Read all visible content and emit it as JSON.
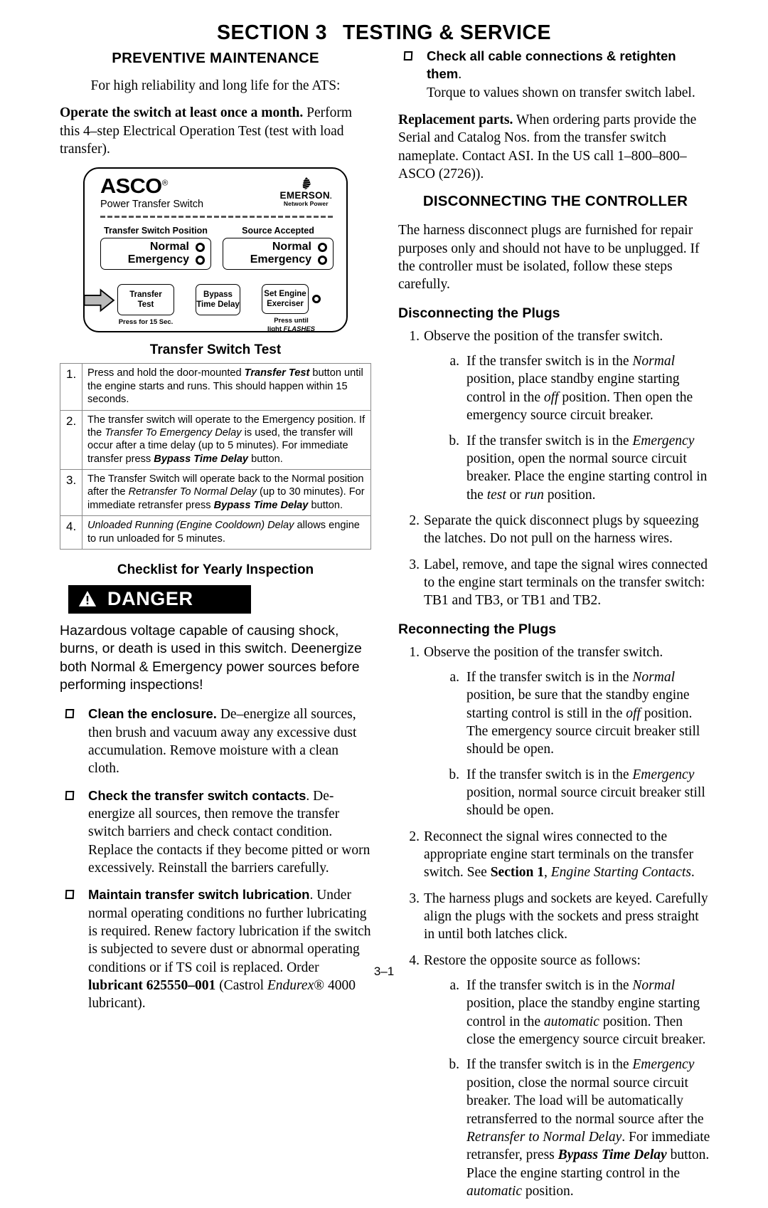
{
  "header": {
    "section_number": "SECTION 3",
    "title": "TESTING & SERVICE"
  },
  "left_column": {
    "heading": "PREVENTIVE MAINTENANCE",
    "intro_line": "For high reliability and long life for the ATS:",
    "operate_bold": "Operate the switch at least once a month.",
    "operate_rest": " Perform this 4–step Electrical Operation Test (test with load transfer).",
    "panel": {
      "brand": "ASCO",
      "brand_reg": "®",
      "brand_sub": "Power Transfer Switch",
      "partner_name": "EMERSON",
      "partner_dot": ".",
      "partner_tagline": "Network Power",
      "indicator_groups": [
        {
          "title": "Transfer Switch Position",
          "rows": [
            "Normal",
            "Emergency"
          ]
        },
        {
          "title": "Source Accepted",
          "rows": [
            "Normal",
            "Emergency"
          ]
        }
      ],
      "buttons": [
        {
          "line1": "Transfer",
          "line2": "Test",
          "note": "Press for 15 Sec.",
          "has_led": false
        },
        {
          "line1": "Bypass",
          "line2": "Time Delay",
          "note": "",
          "has_led": false
        },
        {
          "line1": "Set Engine",
          "line2": "Exerciser",
          "note_line1": "Press until",
          "note_line2_plain": "light ",
          "note_line2_italic": "FLASHES",
          "has_led": true
        }
      ]
    },
    "transfer_test": {
      "title": "Transfer Switch Test",
      "rows": [
        {
          "num": "1.",
          "segments": [
            {
              "t": "Press and hold the door-mounted ",
              "s": "plain"
            },
            {
              "t": "Transfer Test",
              "s": "bolditalic"
            },
            {
              "t": " button until the engine starts and runs. This should happen within 15 seconds.",
              "s": "plain"
            }
          ]
        },
        {
          "num": "2.",
          "segments": [
            {
              "t": "The transfer switch will operate to the Emergency position.  If the ",
              "s": "plain"
            },
            {
              "t": "Transfer To Emergency Delay",
              "s": "italic"
            },
            {
              "t": " is used, the transfer will occur after a time delay (up to 5 minutes). For immediate transfer press ",
              "s": "plain"
            },
            {
              "t": "Bypass Time Delay",
              "s": "bolditalic"
            },
            {
              "t": " button.",
              "s": "plain"
            }
          ]
        },
        {
          "num": "3.",
          "segments": [
            {
              "t": "The Transfer Switch will operate back to the Normal position after the ",
              "s": "plain"
            },
            {
              "t": "Retransfer To Normal Delay",
              "s": "italic"
            },
            {
              "t": " (up to 30 minutes).  For immediate retransfer press ",
              "s": "plain"
            },
            {
              "t": "Bypass Time Delay",
              "s": "bolditalic"
            },
            {
              "t": " button.",
              "s": "plain"
            }
          ]
        },
        {
          "num": "4.",
          "segments": [
            {
              "t": "Unloaded Running (Engine Cooldown) Delay",
              "s": "italic"
            },
            {
              "t": " allows engine to run unloaded for 5 minutes.",
              "s": "plain"
            }
          ]
        }
      ]
    },
    "checklist_title": "Checklist for Yearly Inspection",
    "danger": {
      "label": "DANGER",
      "icon": "warning-triangle-icon",
      "text": "Hazardous voltage capable of causing shock, burns, or death is used in this switch. Deenergize both Normal & Emergency power sources before performing inspections!"
    },
    "checklist_items": [
      {
        "lead": "Clean the enclosure.",
        "body": " De–energize all sources, then brush and vacuum away any excessive dust accumulation. Remove moisture with a clean cloth."
      },
      {
        "lead": "Check the transfer switch contacts",
        "body": ".  De-energize all sources, then remove the transfer switch barriers and check contact condition.  Replace the contacts if they become pitted or worn excessively.  Reinstall the barriers carefully."
      },
      {
        "lead": "Maintain transfer switch lubrication",
        "body": ". Under normal operating conditions no further lubricating is required.  Renew factory lubrication if the switch is subjected to severe dust or abnormal operating conditions or if TS coil is replaced. Order ",
        "order_bold": "lubricant 625550–001",
        "tail_plain_1": " (Castrol ",
        "tail_italic": "Endurex",
        "tail_reg": "®",
        "tail_plain_2": " 4000 lubricant)."
      }
    ]
  },
  "right_column": {
    "cable_item": {
      "lead": "Check all cable connections & retighten them",
      "lead_tail": ".",
      "body": "Torque to values shown on transfer switch label."
    },
    "replacement_parts": {
      "lead": "Replacement parts.",
      "body": " When ordering parts provide the Serial and Catalog Nos. from the transfer switch nameplate.  Contact ASI. In the US call 1–800–800–ASCO (2726))."
    },
    "heading": "DISCONNECTING THE CONTROLLER",
    "intro": "The harness disconnect plugs are furnished for repair purposes only and should not have to be unplugged. If the controller must be isolated, follow these steps carefully.",
    "disconnect": {
      "title": "Disconnecting the Plugs",
      "steps": [
        {
          "mk": "1.",
          "segments": [
            {
              "t": "Observe the position of the transfer switch.",
              "s": "plain"
            }
          ],
          "subs": [
            {
              "mk": "a.",
              "segments": [
                {
                  "t": "If the transfer switch is in the ",
                  "s": "plain"
                },
                {
                  "t": "Normal",
                  "s": "italic"
                },
                {
                  "t": " position, place standby engine starting control in the ",
                  "s": "plain"
                },
                {
                  "t": "off",
                  "s": "italic"
                },
                {
                  "t": " position.  Then open the emergency source circuit breaker.",
                  "s": "plain"
                }
              ]
            },
            {
              "mk": "b.",
              "segments": [
                {
                  "t": "If the transfer switch is in the ",
                  "s": "plain"
                },
                {
                  "t": "Emergency",
                  "s": "italic"
                },
                {
                  "t": " position, open the normal source circuit breaker.  Place the engine starting control in the ",
                  "s": "plain"
                },
                {
                  "t": "test",
                  "s": "italic"
                },
                {
                  "t": " or ",
                  "s": "plain"
                },
                {
                  "t": "run",
                  "s": "italic"
                },
                {
                  "t": " position.",
                  "s": "plain"
                }
              ]
            }
          ]
        },
        {
          "mk": "2.",
          "segments": [
            {
              "t": "Separate the quick disconnect plugs by squeezing the latches.  Do not pull on the harness wires.",
              "s": "plain"
            }
          ],
          "subs": []
        },
        {
          "mk": "3.",
          "segments": [
            {
              "t": "Label, remove, and tape the signal wires connected to the engine start terminals on the transfer switch: TB1 and TB3, or TB1 and TB2.",
              "s": "plain"
            }
          ],
          "subs": []
        }
      ]
    },
    "reconnect": {
      "title": "Reconnecting the Plugs",
      "steps": [
        {
          "mk": "1.",
          "segments": [
            {
              "t": "Observe the position of the transfer switch.",
              "s": "plain"
            }
          ],
          "subs": [
            {
              "mk": "a.",
              "segments": [
                {
                  "t": "If the transfer switch is in the ",
                  "s": "plain"
                },
                {
                  "t": "Normal",
                  "s": "italic"
                },
                {
                  "t": " position, be sure that the standby engine starting control is still in the ",
                  "s": "plain"
                },
                {
                  "t": "off",
                  "s": "italic"
                },
                {
                  "t": " position.  The emergency source circuit breaker still should be open.",
                  "s": "plain"
                }
              ]
            },
            {
              "mk": "b.",
              "segments": [
                {
                  "t": "If the transfer switch is in the ",
                  "s": "plain"
                },
                {
                  "t": "Emergency",
                  "s": "italic"
                },
                {
                  "t": " position, normal source circuit breaker still should be open.",
                  "s": "plain"
                }
              ]
            }
          ]
        },
        {
          "mk": "2.",
          "segments": [
            {
              "t": "Reconnect the signal wires connected to the appropriate engine start terminals on the transfer switch.  See ",
              "s": "plain"
            },
            {
              "t": "Section 1",
              "s": "bold"
            },
            {
              "t": ", ",
              "s": "plain"
            },
            {
              "t": "Engine Starting Contacts",
              "s": "italic"
            },
            {
              "t": ".",
              "s": "plain"
            }
          ],
          "subs": []
        },
        {
          "mk": "3.",
          "segments": [
            {
              "t": "The harness plugs and sockets are keyed. Carefully align the plugs with the sockets and press straight in until both latches click.",
              "s": "plain"
            }
          ],
          "subs": []
        },
        {
          "mk": "4.",
          "segments": [
            {
              "t": "Restore the opposite source as follows:",
              "s": "plain"
            }
          ],
          "subs": [
            {
              "mk": "a.",
              "segments": [
                {
                  "t": "If the transfer switch is in the ",
                  "s": "plain"
                },
                {
                  "t": "Normal",
                  "s": "italic"
                },
                {
                  "t": " position, place the standby engine starting control in the ",
                  "s": "plain"
                },
                {
                  "t": "automatic",
                  "s": "italic"
                },
                {
                  "t": " position.  Then close the emergency source circuit breaker.",
                  "s": "plain"
                }
              ]
            },
            {
              "mk": "b.",
              "segments": [
                {
                  "t": "If the transfer switch is in the ",
                  "s": "plain"
                },
                {
                  "t": "Emergency",
                  "s": "italic"
                },
                {
                  "t": " position, close the normal source circuit breaker. The load will be automatically retransferred to the normal source after the ",
                  "s": "plain"
                },
                {
                  "t": "Retransfer to Normal Delay",
                  "s": "italic"
                },
                {
                  "t": ". For immediate retransfer, press ",
                  "s": "plain"
                },
                {
                  "t": "Bypass Time Delay",
                  "s": "bolditalic"
                },
                {
                  "t": " button.  Place the engine starting control in the ",
                  "s": "plain"
                },
                {
                  "t": "automatic",
                  "s": "italic"
                },
                {
                  "t": " position.",
                  "s": "plain"
                }
              ]
            }
          ]
        }
      ]
    }
  },
  "footer": {
    "page_number": "3–1"
  }
}
